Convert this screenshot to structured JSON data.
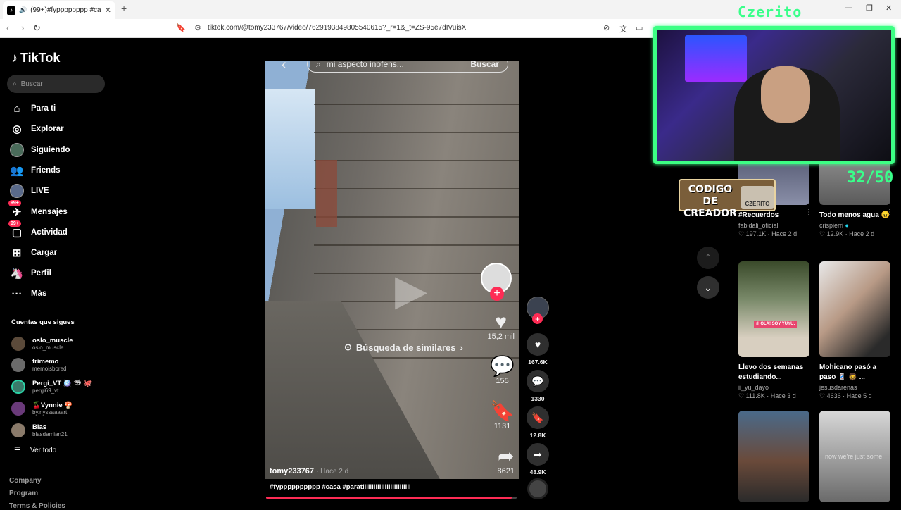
{
  "browser": {
    "tab_title": "(99+)#fypppppppp #casa #...",
    "new_tab": "+",
    "url": "tiktok.com/@tomy233767/video/7629193849805540615?_r=1&_t=ZS-95e7dIVuisX"
  },
  "sidebar": {
    "logo": "TikTok",
    "search_placeholder": "Buscar",
    "nav": [
      {
        "label": "Para ti",
        "icon": "home-icon"
      },
      {
        "label": "Explorar",
        "icon": "compass-icon"
      },
      {
        "label": "Siguiendo",
        "icon": "avatar"
      },
      {
        "label": "Friends",
        "icon": "friends-icon"
      },
      {
        "label": "LIVE",
        "icon": "avatar"
      },
      {
        "label": "Mensajes",
        "icon": "message-icon",
        "badge": "99+"
      },
      {
        "label": "Actividad",
        "icon": "activity-icon",
        "badge": "99+"
      },
      {
        "label": "Cargar",
        "icon": "plus-square-icon"
      },
      {
        "label": "Perfil",
        "icon": "profile-icon"
      },
      {
        "label": "Más",
        "icon": "more-icon"
      }
    ],
    "following_title": "Cuentas que sigues",
    "following": [
      {
        "name": "oslo_muscle",
        "handle": "oslo_muscle"
      },
      {
        "name": "frimemo",
        "handle": "memoisbored"
      },
      {
        "name": "Pergi_VT 🪩 🦈 🐙",
        "handle": "pergi69_vt"
      },
      {
        "name": "🍒Vynnie 🍄",
        "handle": "by.nyssaaaart"
      },
      {
        "name": "Blas",
        "handle": "blasdamian21"
      }
    ],
    "see_all": "Ver todo",
    "footer": [
      "Company",
      "Program",
      "Terms & Policies"
    ]
  },
  "video": {
    "inner_search": "mi aspecto inofens...",
    "inner_search_btn": "Buscar",
    "similar": "Búsqueda de similares",
    "inner_likes": "15,2 mil",
    "inner_comments": "155",
    "inner_saves": "1131",
    "inner_shares": "8621",
    "author": "tomy233767",
    "time": "Hace 2 d",
    "caption": "#fypppppppppp #casa #paratiiiiiiiiiiiiiiiiiiiiiiiiii",
    "progress": 0.98
  },
  "actions": {
    "likes": "167.6K",
    "comments": "1330",
    "saves": "12.8K",
    "shares": "48.9K"
  },
  "overlay": {
    "streamer_name": "Czerito",
    "creator_code_line1": "CODIGO",
    "creator_code_line2": "DE CREADOR",
    "creator_code_tag": "CZERITO",
    "score": "32/50"
  },
  "grid": [
    {
      "title": "#Recuerdos",
      "user": "fabidali_oficial",
      "likes": "197.1K",
      "time": "Hace 2 d"
    },
    {
      "title": "Todo menos agua 😠",
      "user": "crispierri",
      "likes": "12.9K",
      "time": "Hace 2 d"
    },
    {
      "title": "Llevo dos semanas estudiando...",
      "user": "ii_yu_dayo",
      "likes": "111.8K",
      "time": "Hace 3 d",
      "thumb_label": "¡HOLA! SOY YUYU."
    },
    {
      "title": "Mohicano pasó a paso 💈 🧔 ...",
      "user": "jesusdarenas",
      "likes": "4636",
      "time": "Hace 5 d"
    },
    {
      "title": "",
      "user": "",
      "likes": "",
      "time": ""
    },
    {
      "title": "",
      "user": "",
      "likes": "",
      "time": "",
      "thumb_overlay": "now we're just some"
    }
  ]
}
